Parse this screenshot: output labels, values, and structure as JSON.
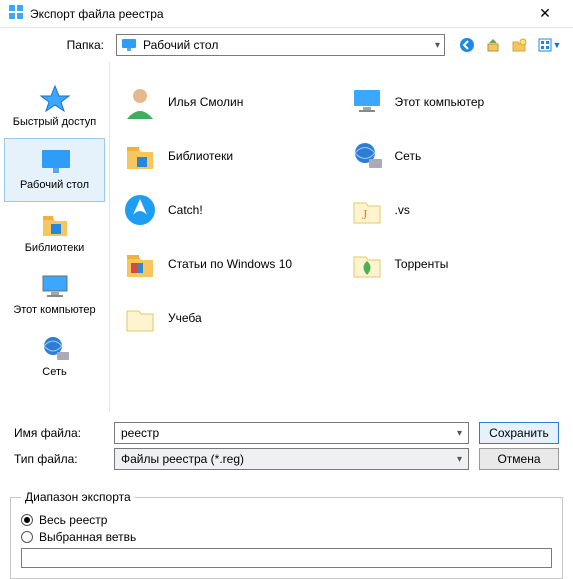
{
  "window": {
    "title": "Экспорт файла реестра",
    "close": "✕"
  },
  "folder": {
    "label": "Папка:",
    "current": "Рабочий стол"
  },
  "toolbar": {
    "back": "back-icon",
    "up": "up-icon",
    "newfolder": "new-folder-icon",
    "views": "views-icon"
  },
  "places": [
    {
      "id": "quick",
      "label": "Быстрый доступ",
      "icon": "star"
    },
    {
      "id": "desktop",
      "label": "Рабочий стол",
      "icon": "desktop",
      "selected": true
    },
    {
      "id": "libraries",
      "label": "Библиотеки",
      "icon": "libraries"
    },
    {
      "id": "computer",
      "label": "Этот компьютер",
      "icon": "computer"
    },
    {
      "id": "network",
      "label": "Сеть",
      "icon": "network"
    }
  ],
  "items": [
    {
      "label": "Илья Смолин",
      "icon": "user"
    },
    {
      "label": "Этот компьютер",
      "icon": "computer"
    },
    {
      "label": "Библиотеки",
      "icon": "libraries"
    },
    {
      "label": "Сеть",
      "icon": "network"
    },
    {
      "label": "Catch!",
      "icon": "catch"
    },
    {
      "label": ".vs",
      "icon": "vs"
    },
    {
      "label": "Статьи по Windows 10",
      "icon": "folder"
    },
    {
      "label": "Торренты",
      "icon": "torrent"
    },
    {
      "label": "Учеба",
      "icon": "folder"
    }
  ],
  "fields": {
    "name_label": "Имя файла:",
    "name_value": "реестр",
    "type_label": "Тип файла:",
    "type_value": "Файлы реестра (*.reg)",
    "save": "Сохранить",
    "cancel": "Отмена"
  },
  "range": {
    "legend": "Диапазон экспорта",
    "all": "Весь реестр",
    "branch": "Выбранная ветвь",
    "selected": "all",
    "branch_value": ""
  }
}
